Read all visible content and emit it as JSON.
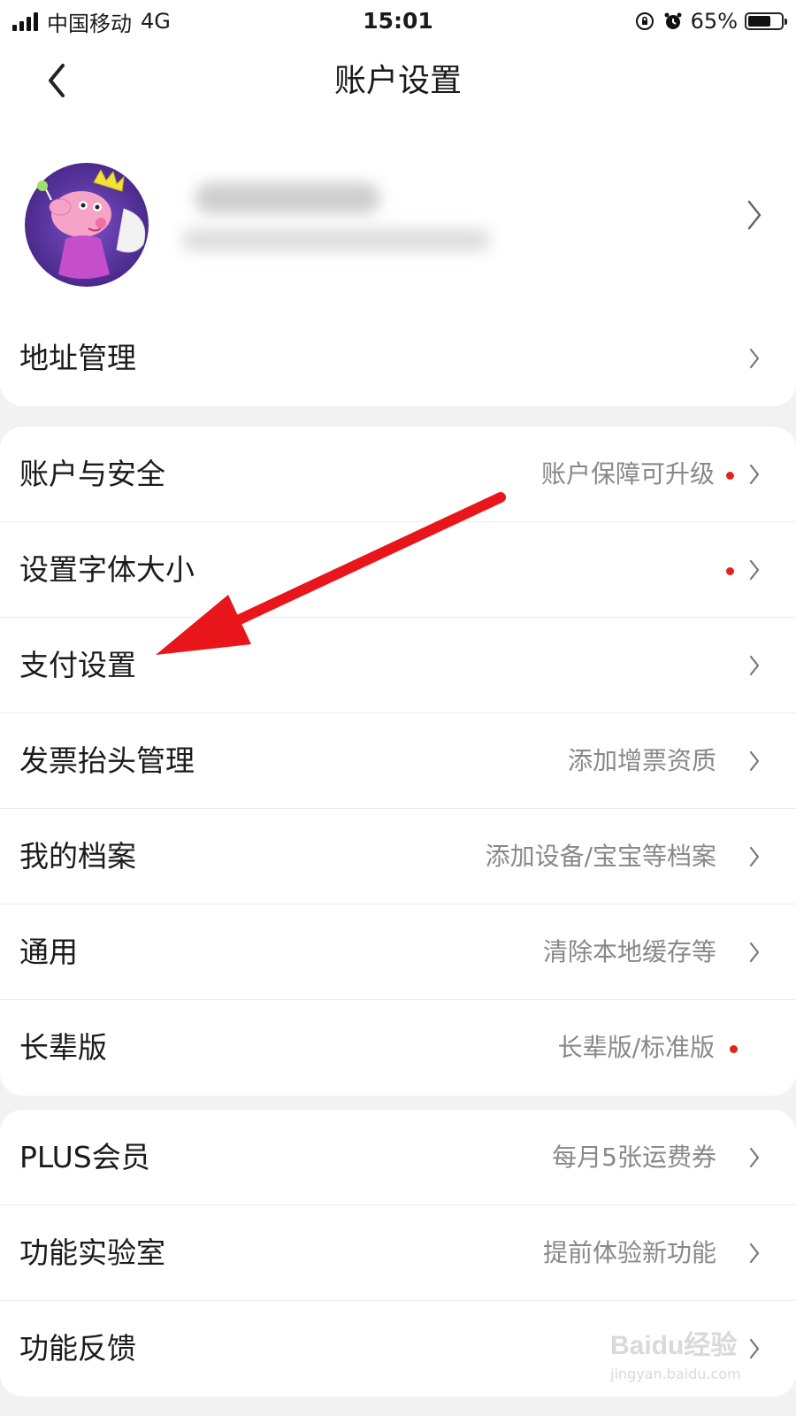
{
  "status_bar": {
    "carrier": "中国移动",
    "network": "4G",
    "time": "15:01",
    "battery": "65%",
    "icons": [
      "signal-icon",
      "rotation-lock-icon",
      "alarm-icon",
      "battery-icon"
    ]
  },
  "nav": {
    "title": "账户设置",
    "back_icon": "chevron-left-icon"
  },
  "profile": {
    "avatar": "avatar",
    "chevron_icon": "chevron-right-icon"
  },
  "groups": [
    {
      "rows": [
        {
          "label": "地址管理",
          "value": "",
          "dot": false,
          "chevron": true
        }
      ]
    },
    {
      "rows": [
        {
          "label": "账户与安全",
          "value": "账户保障可升级",
          "dot": true,
          "chevron": true
        },
        {
          "label": "设置字体大小",
          "value": "",
          "dot": true,
          "chevron": true
        },
        {
          "label": "支付设置",
          "value": "",
          "dot": false,
          "chevron": true
        },
        {
          "label": "发票抬头管理",
          "value": "添加增票资质",
          "dot": false,
          "chevron": true
        },
        {
          "label": "我的档案",
          "value": "添加设备/宝宝等档案",
          "dot": false,
          "chevron": true
        },
        {
          "label": "通用",
          "value": "清除本地缓存等",
          "dot": false,
          "chevron": true
        },
        {
          "label": "长辈版",
          "value": "长辈版/标准版",
          "dot": true,
          "chevron": false
        }
      ]
    },
    {
      "rows": [
        {
          "label": "PLUS会员",
          "value": "每月5张运费券",
          "dot": false,
          "chevron": true
        },
        {
          "label": "功能实验室",
          "value": "提前体验新功能",
          "dot": false,
          "chevron": true
        },
        {
          "label": "功能反馈",
          "value": "",
          "dot": false,
          "chevron": true
        }
      ]
    }
  ],
  "colors": {
    "background": "#f2f2f2",
    "card": "#ffffff",
    "dot": "#e2231a",
    "annotation_arrow": "#e8161b",
    "secondary_text": "#888888"
  },
  "watermark": {
    "brand": "Baidu经验",
    "url": "jingyan.baidu.com"
  }
}
